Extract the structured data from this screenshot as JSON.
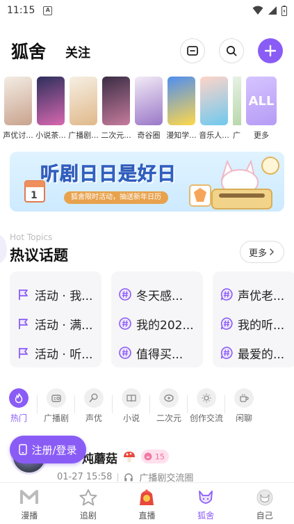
{
  "status_bar": {
    "time": "11:15",
    "badge": "A"
  },
  "header": {
    "title": "狐舍",
    "follow_tab": "关注"
  },
  "circles": [
    {
      "label": "声优讨...",
      "colors": [
        "#f3ece4",
        "#c9a38d"
      ]
    },
    {
      "label": "小说茶...",
      "colors": [
        "#2d2f5c",
        "#d868b0"
      ]
    },
    {
      "label": "广播剧...",
      "colors": [
        "#f6efe4",
        "#e0b98a"
      ]
    },
    {
      "label": "二次元...",
      "colors": [
        "#3a2d45",
        "#c77b9c"
      ]
    },
    {
      "label": "奇谷圈",
      "colors": [
        "#f2eaf6",
        "#9a78c8"
      ]
    },
    {
      "label": "漫知学...",
      "colors": [
        "#4f8ef0",
        "#ffd84a"
      ]
    },
    {
      "label": "音乐人...",
      "colors": [
        "#ffd4c8",
        "#6ec9ef"
      ]
    },
    {
      "label": "广...",
      "colors": [
        "#eaf3e8",
        "#b5d6a8"
      ]
    },
    {
      "label": "更多",
      "more_text": "ALL"
    }
  ],
  "banner": {
    "title": "听剧日日是好日",
    "subtitle": "狐舍限时活动，抽送新年日历",
    "calendar_day": "1"
  },
  "hot_topics": {
    "title_en": "Hot Topics",
    "title": "热议话题",
    "more": "更多",
    "columns": [
      {
        "icon": "flag",
        "items": [
          "活动 · 我...",
          "活动 · 满...",
          "活动 · 听..."
        ]
      },
      {
        "icon": "hash",
        "items": [
          "冬天感...",
          "我的202...",
          "值得买..."
        ]
      },
      {
        "icon": "hash-bubble",
        "items": [
          "声优老...",
          "我的听...",
          "最爱的..."
        ]
      }
    ]
  },
  "categories": [
    {
      "label": "热门",
      "active": true
    },
    {
      "label": "广播剧"
    },
    {
      "label": "声优"
    },
    {
      "label": "小说"
    },
    {
      "label": "二次元"
    },
    {
      "label": "创作交流"
    },
    {
      "label": "闲聊"
    }
  ],
  "post": {
    "name": "炖蘑菇",
    "level": "15",
    "time": "01-27 15:58",
    "circle": "广播剧交流圈"
  },
  "login_button": "注册/登录",
  "tabs": [
    {
      "label": "漫播"
    },
    {
      "label": "追剧"
    },
    {
      "label": "直播"
    },
    {
      "label": "狐舍",
      "active": true
    },
    {
      "label": "自己"
    }
  ],
  "colors": {
    "accent": "#8a5cf6"
  }
}
